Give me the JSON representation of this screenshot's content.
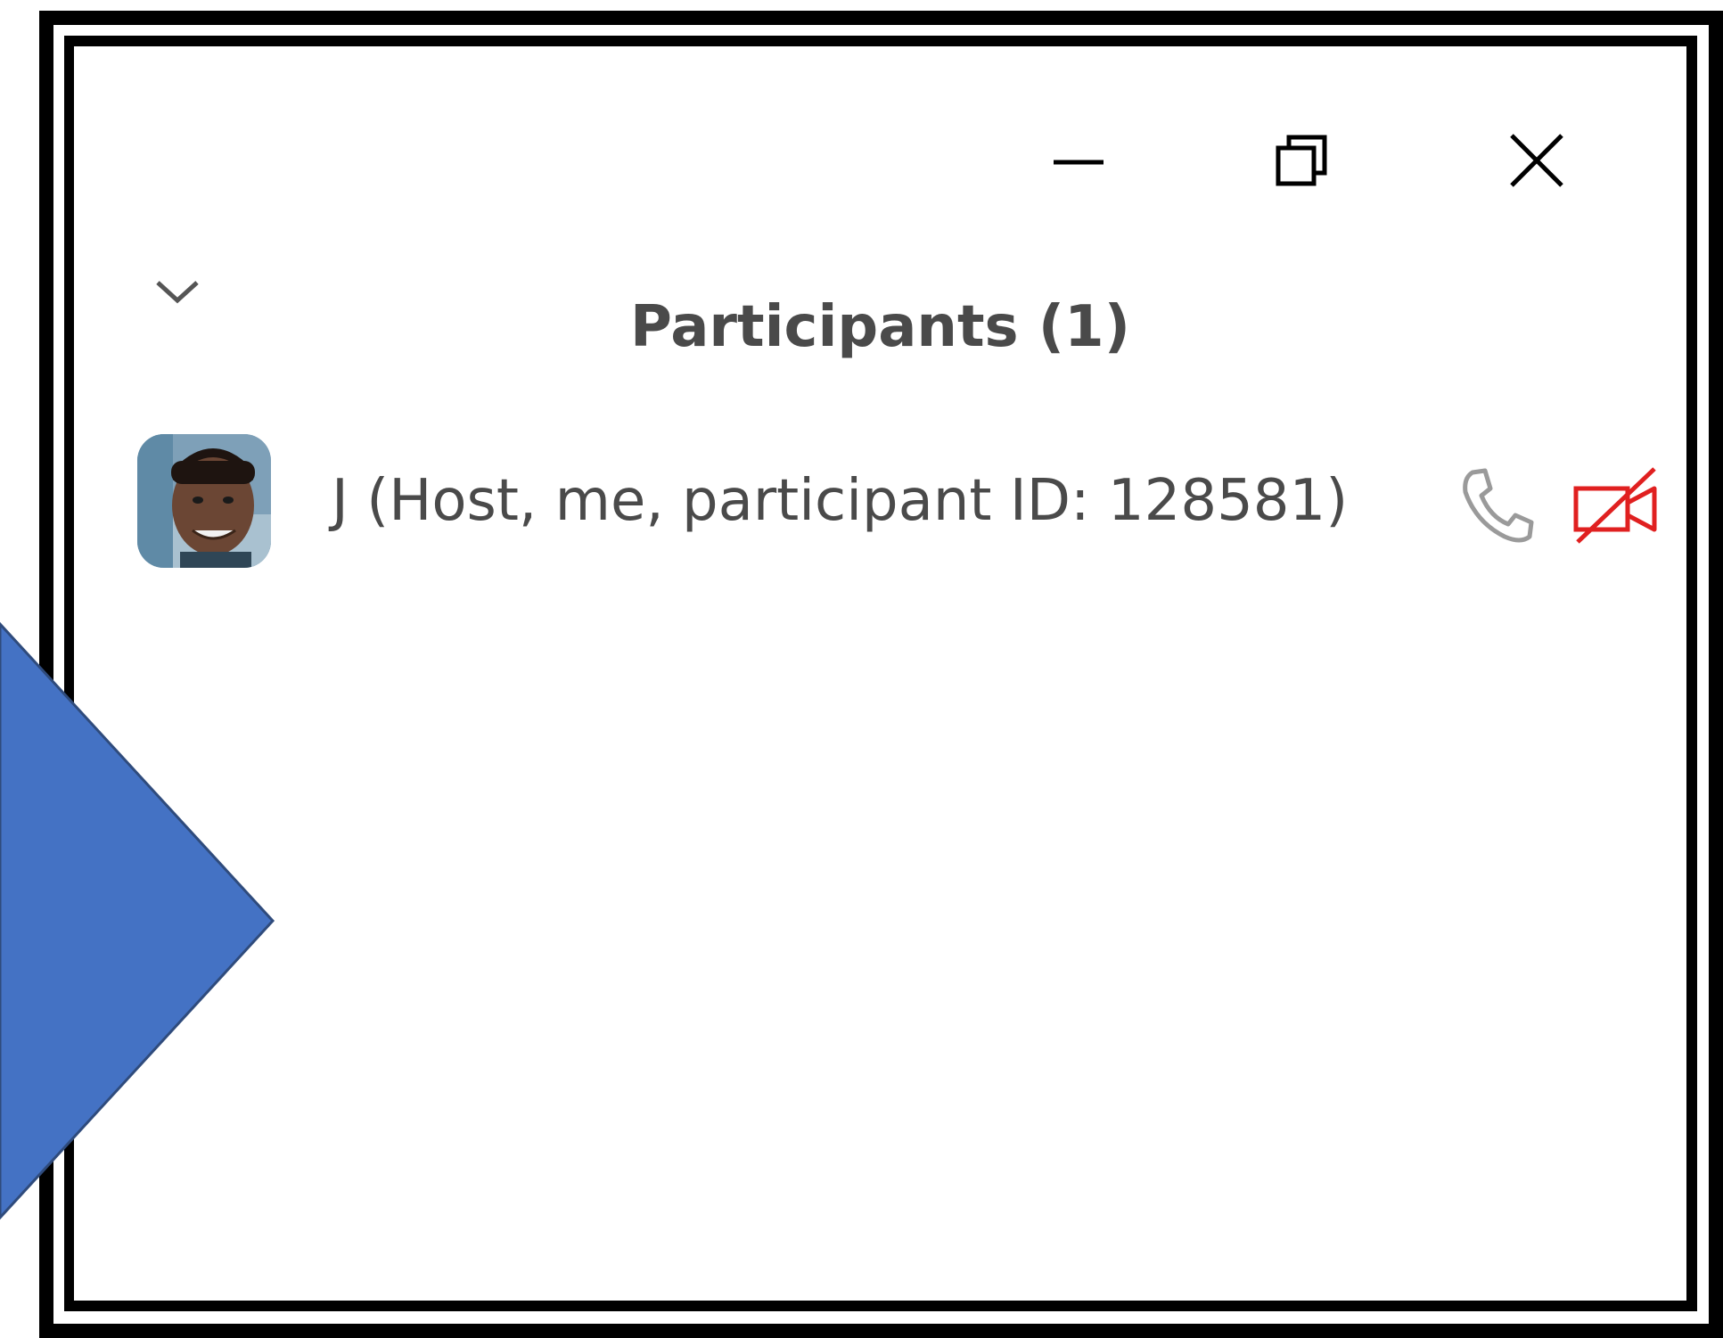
{
  "window": {
    "controls": {
      "minimize_icon": "minimize-icon",
      "restore_icon": "restore-icon",
      "close_icon": "close-icon"
    }
  },
  "panel": {
    "title": "Participants (1)",
    "collapse_icon": "chevron-down-icon"
  },
  "participants": [
    {
      "name": "J (Host, me, participant ID: 128581)",
      "audio_icon": "phone-icon",
      "video_icon": "video-off-icon",
      "video_status_color": "#e02020"
    }
  ],
  "colors": {
    "frame": "#000000",
    "arrow_fill": "#4472c4",
    "arrow_stroke": "#2f4b7c",
    "text": "#4a4a4a",
    "muted_icon": "#9a9a9a"
  }
}
